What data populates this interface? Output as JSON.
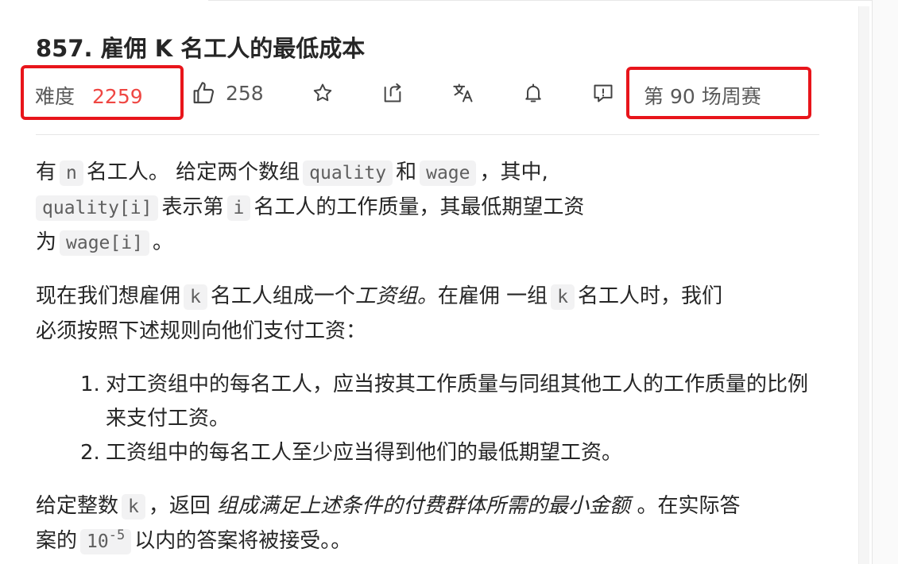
{
  "problem": {
    "title": "857. 雇佣 K 名工人的最低成本",
    "difficulty_label": "难度",
    "difficulty_rating": "2259",
    "likes": "258",
    "contest": "第 90 场周赛"
  },
  "icons": [
    "thumbs-up-icon",
    "star-icon",
    "share-icon",
    "translate-icon",
    "bell-icon",
    "feedback-icon"
  ],
  "highlight_color": "#e8151b",
  "rating_color": "#ef4743",
  "description": {
    "p1": {
      "t1": "有",
      "c1": "n",
      "t2": "名工人。 给定两个数组",
      "c2": "quality",
      "t3": "和",
      "c3": "wage",
      "t4": "，其中,",
      "c4": "quality[i]",
      "t5": "表示第",
      "c5": "i",
      "t6": "名工人的工作质量，其最低期望工资",
      "t7": "为",
      "c6": "wage[i]",
      "t8": "。"
    },
    "p2": {
      "t1": "现在我们想雇佣",
      "c1": "k",
      "t2": "名工人组成一个",
      "em1": "工资组。",
      "t3": "在雇佣 一组",
      "c2": "k",
      "t4": "名工人时，我们",
      "t5": "必须按照下述规则向他们支付工资："
    },
    "rules": [
      "对工资组中的每名工人，应当按其工作质量与同组其他工人的工作质量的比例来支付工资。",
      "工资组中的每名工人至少应当得到他们的最低期望工资。"
    ],
    "rule_nums": [
      "1.",
      "2."
    ],
    "p3": {
      "t1": "给定整数",
      "c1": "k",
      "t2": "，返回",
      "em1": "组成满足上述条件的付费群体所需的最小金额",
      "t3": "。在实际答",
      "t4": "案的",
      "c2_base": "10",
      "c2_sup": "-5",
      "t5": "以内的答案将被接受。。"
    }
  }
}
